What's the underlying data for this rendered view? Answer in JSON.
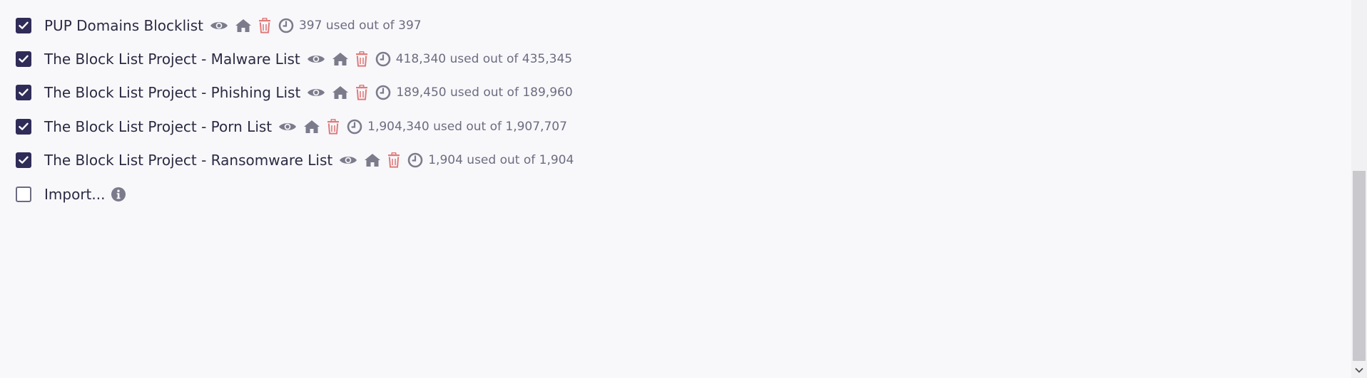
{
  "colors": {
    "checkbox_fill": "#2f2c58",
    "text": "#2b2a42",
    "muted": "#6d6c80",
    "icon": "#7c7b8c",
    "trash": "#e07b7b"
  },
  "blocklists": [
    {
      "name": "PUP Domains Blocklist",
      "checked": true,
      "usage": "397 used out of 397"
    },
    {
      "name": "The Block List Project - Malware List",
      "checked": true,
      "usage": "418,340 used out of 435,345"
    },
    {
      "name": "The Block List Project - Phishing List",
      "checked": true,
      "usage": "189,450 used out of 189,960"
    },
    {
      "name": "The Block List Project - Porn List",
      "checked": true,
      "usage": "1,904,340 used out of 1,907,707"
    },
    {
      "name": "The Block List Project - Ransomware List",
      "checked": true,
      "usage": "1,904 used out of 1,904"
    }
  ],
  "import_row": {
    "label": "Import...",
    "checked": false
  },
  "icons": {
    "view": "eye-icon",
    "homepage": "home-icon",
    "delete": "trash-icon",
    "last_update": "clock-icon",
    "info": "info-icon"
  }
}
